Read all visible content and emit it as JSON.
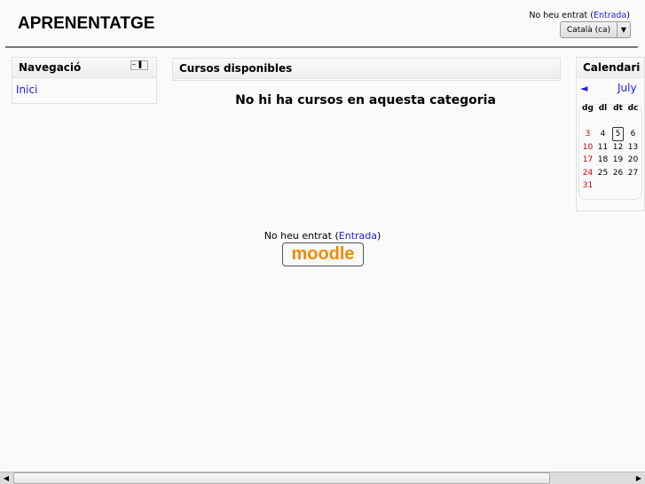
{
  "site_title": "APRENENTATGE",
  "login": {
    "text": "No heu entrat (",
    "link": "Entrada",
    "close": ")"
  },
  "language": {
    "selected": "Català (ca)"
  },
  "navigation": {
    "title": "Navegació",
    "items": [
      {
        "label": "Inici"
      }
    ]
  },
  "courses": {
    "title": "Cursos disponibles",
    "empty_message": "No hi ha cursos en aquesta categoria"
  },
  "calendar": {
    "title": "Calendari",
    "prev": "◄",
    "month": "July",
    "weekdays": [
      "dg",
      "dl",
      "dt",
      "dc"
    ],
    "weeks": [
      [
        "",
        "",
        "",
        ""
      ],
      [
        "3",
        "4",
        "5",
        "6"
      ],
      [
        "10",
        "11",
        "12",
        "13"
      ],
      [
        "17",
        "18",
        "19",
        "20"
      ],
      [
        "24",
        "25",
        "26",
        "27"
      ],
      [
        "31",
        "",
        "",
        ""
      ]
    ],
    "today": "5",
    "weekend_color": "#cc0000"
  },
  "footer": {
    "text": "No heu entrat (",
    "link": "Entrada",
    "close": ")",
    "logo": "moodle"
  }
}
